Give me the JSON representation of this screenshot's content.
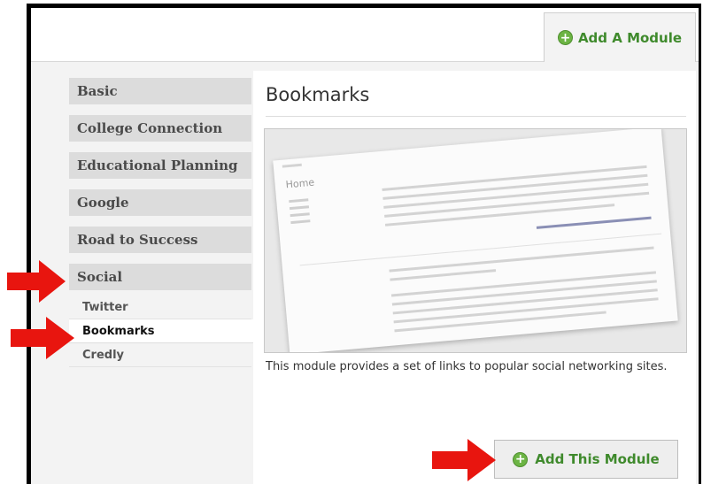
{
  "header": {
    "add_module_label": "Add A Module",
    "add_icon": "plus-circle-icon"
  },
  "sidebar": {
    "categories": [
      {
        "label": "Basic"
      },
      {
        "label": "College Connection"
      },
      {
        "label": "Educational Planning"
      },
      {
        "label": "Google"
      },
      {
        "label": "Road to Success"
      },
      {
        "label": "Social"
      }
    ],
    "sub_items": [
      {
        "label": "Twitter",
        "active": false
      },
      {
        "label": "Bookmarks",
        "active": true
      },
      {
        "label": "Credly",
        "active": false
      }
    ]
  },
  "module": {
    "title": "Bookmarks",
    "preview": {
      "home_label": "Home"
    },
    "description": "This module provides a set of links to popular social networking sites.",
    "add_button_label": "Add This Module"
  },
  "colors": {
    "accent_green": "#3f8a2c",
    "arrow_red": "#e8150f"
  }
}
